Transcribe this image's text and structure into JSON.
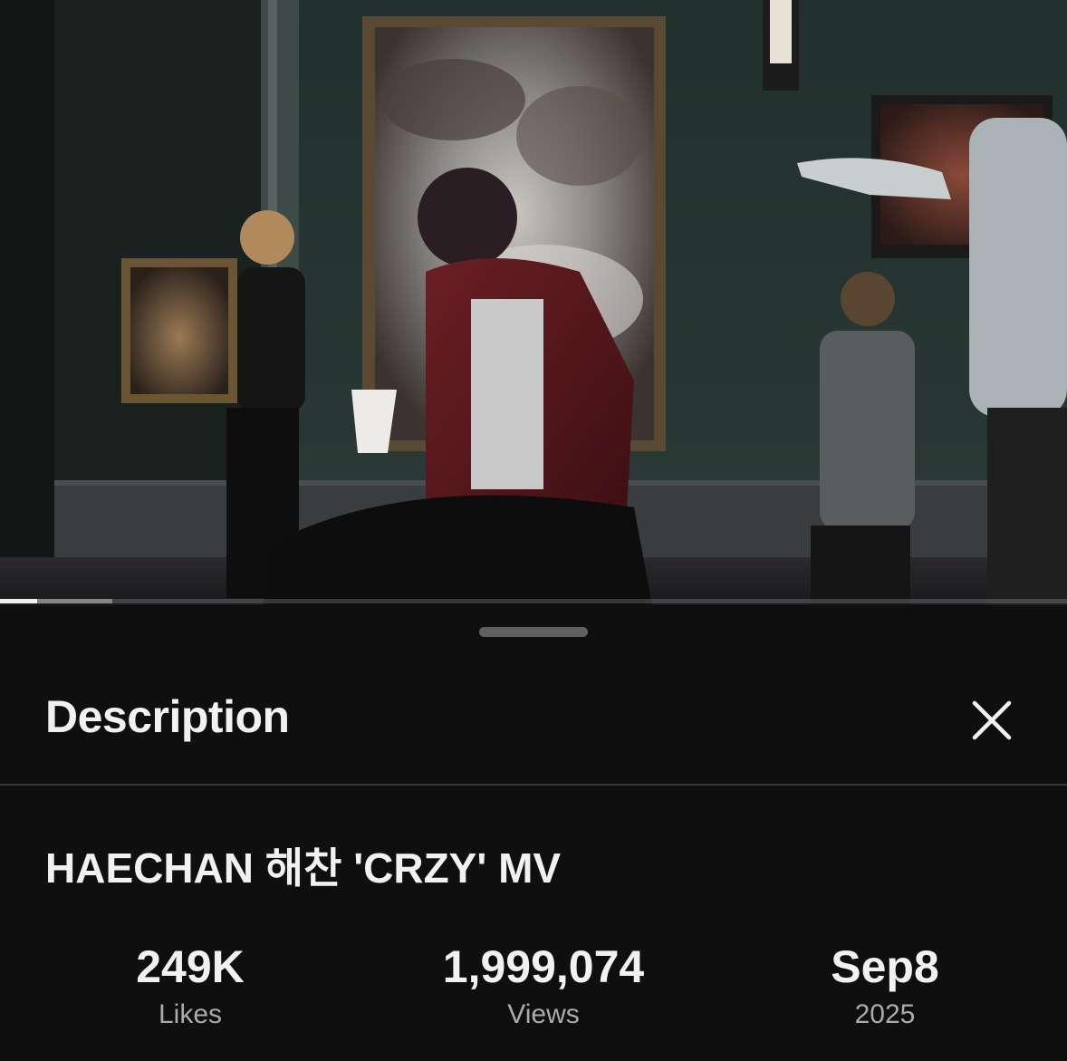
{
  "player": {
    "progress_played_fraction": 0.035,
    "progress_buffered_fraction": 0.105
  },
  "sheet": {
    "title": "Description",
    "close_icon": "close-icon"
  },
  "video": {
    "title": "HAECHAN 해찬 'CRZY' MV"
  },
  "stats": {
    "likes": {
      "value": "249K",
      "label": "Likes"
    },
    "views": {
      "value": "1,999,074",
      "label": "Views"
    },
    "date": {
      "value": "Sep8",
      "label": "2025"
    }
  },
  "colors": {
    "background": "#0f0f0f",
    "text_primary": "#f1f1f1",
    "text_secondary": "#aaaaaa",
    "divider": "#3a3a3a"
  }
}
